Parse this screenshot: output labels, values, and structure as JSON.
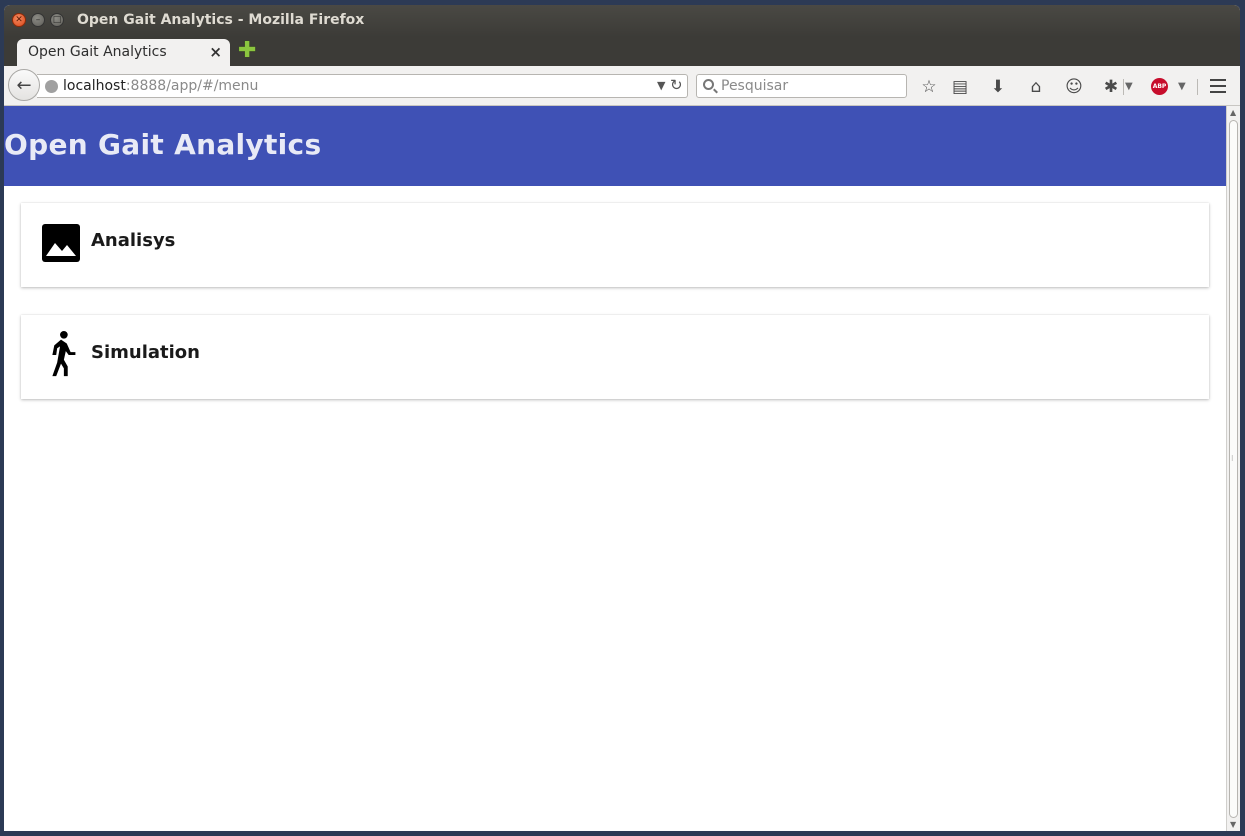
{
  "window": {
    "title": "Open Gait Analytics - Mozilla Firefox"
  },
  "tabs": [
    {
      "label": "Open Gait Analytics"
    }
  ],
  "navbar": {
    "url_host": "localhost",
    "url_rest": ":8888/app/#/menu",
    "search_placeholder": "Pesquisar",
    "abp_badge": "ABP"
  },
  "app": {
    "title": "Open Gait Analytics",
    "header_color": "#3f51b5",
    "menu": [
      {
        "label": "Analisys",
        "icon": "image-icon"
      },
      {
        "label": "Simulation",
        "icon": "walking-person-icon"
      }
    ]
  }
}
